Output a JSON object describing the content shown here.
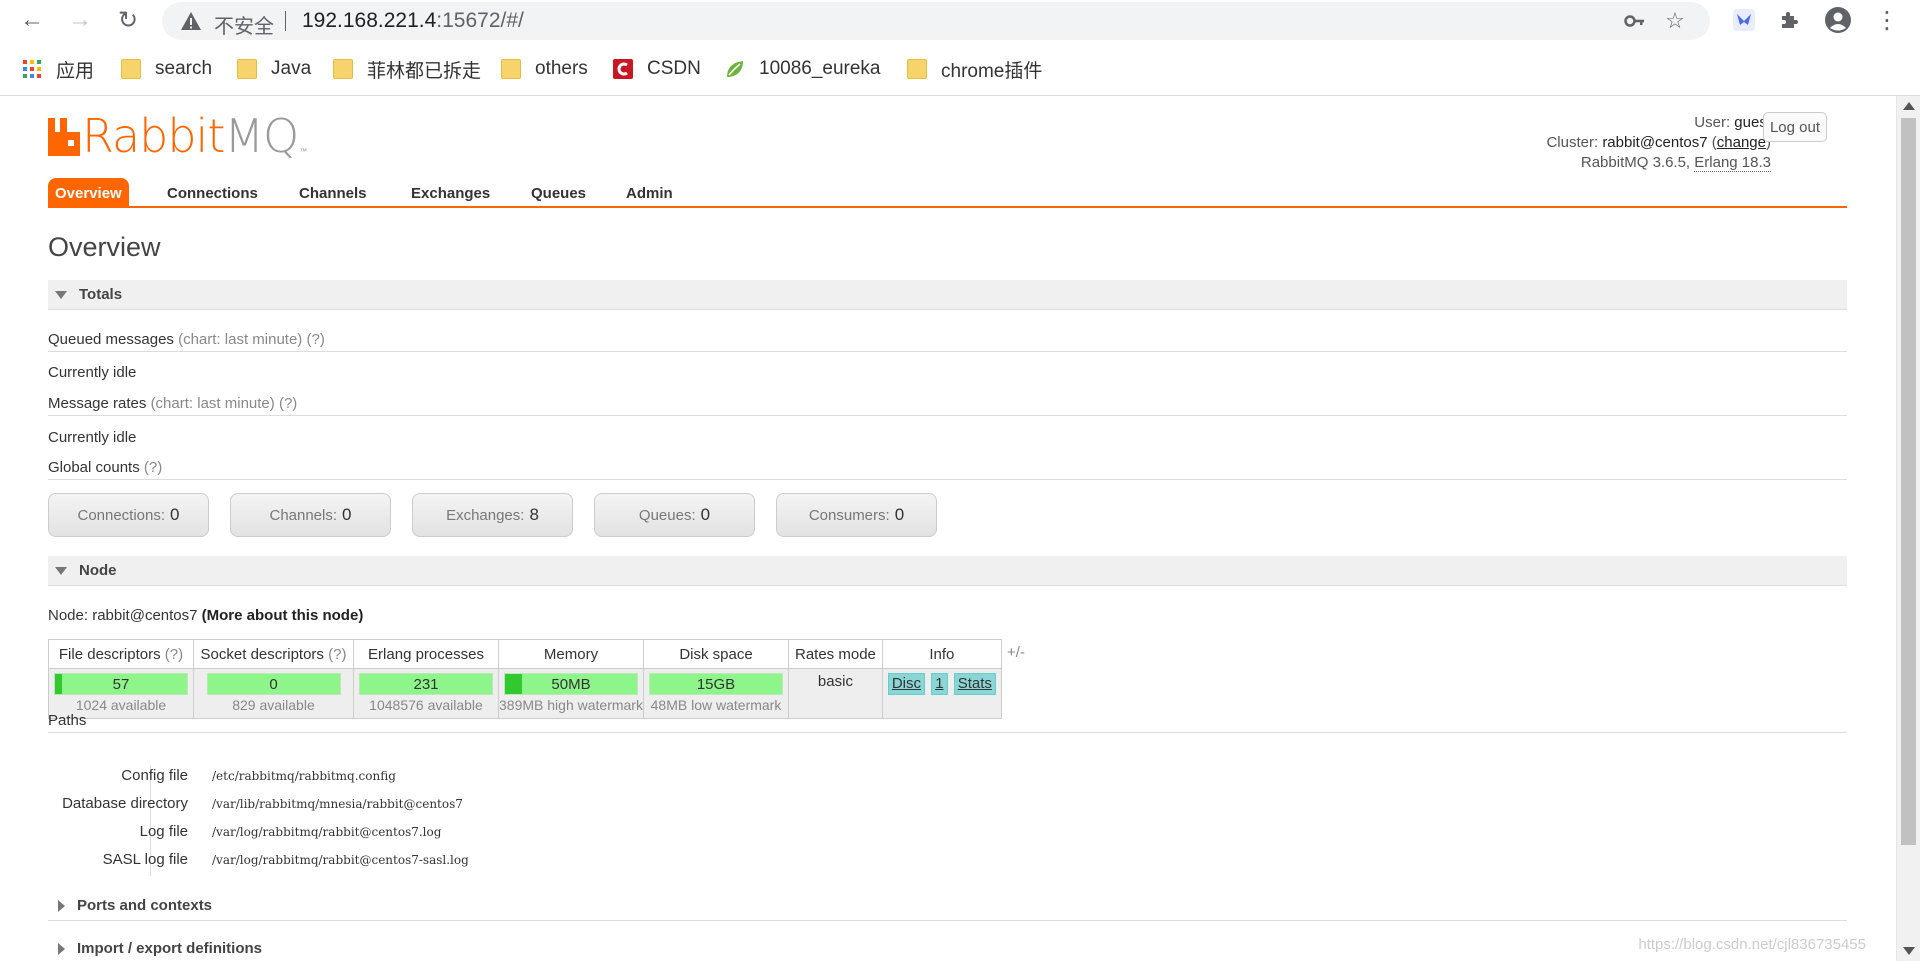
{
  "browser": {
    "insecure_label": "不安全",
    "url_host": "192.168.221.4",
    "url_rest": ":15672/#/",
    "bookmarks": [
      {
        "label": "应用"
      },
      {
        "label": "search"
      },
      {
        "label": "Java"
      },
      {
        "label": "菲林都已拆走"
      },
      {
        "label": "others"
      },
      {
        "label": "CSDN"
      },
      {
        "label": "10086_eureka"
      },
      {
        "label": "chrome插件"
      }
    ]
  },
  "header": {
    "logo_rabbit": "Rabbit",
    "logo_mq": "MQ",
    "logo_tm": "™",
    "user_label": "User:",
    "user_name": "guest",
    "cluster_label": "Cluster:",
    "cluster_name": "rabbit@centos7",
    "cluster_change": "change",
    "version": "RabbitMQ 3.6.5,",
    "erlang": "Erlang 18.3",
    "logout_label": "Log out"
  },
  "tabs": [
    {
      "label": "Overview"
    },
    {
      "label": "Connections"
    },
    {
      "label": "Channels"
    },
    {
      "label": "Exchanges"
    },
    {
      "label": "Queues"
    },
    {
      "label": "Admin"
    }
  ],
  "page_title": "Overview",
  "totals": {
    "title": "Totals",
    "queued_messages": "Queued messages",
    "queued_chart": "(chart: last minute)",
    "help": "(?)",
    "idle1": "Currently idle",
    "message_rates": "Message rates",
    "rates_chart": "(chart: last minute)",
    "idle2": "Currently idle",
    "global_counts": "Global counts",
    "counts": [
      {
        "label": "Connections:",
        "value": "0"
      },
      {
        "label": "Channels:",
        "value": "0"
      },
      {
        "label": "Exchanges:",
        "value": "8"
      },
      {
        "label": "Queues:",
        "value": "0"
      },
      {
        "label": "Consumers:",
        "value": "0"
      }
    ]
  },
  "node": {
    "title": "Node",
    "node_prefix": "Node: rabbit@centos7",
    "more": "(More about this node)",
    "headers": {
      "fd": "File descriptors",
      "sd": "Socket descriptors",
      "ep": "Erlang processes",
      "mem": "Memory",
      "disk": "Disk space",
      "rates": "Rates mode",
      "info": "Info",
      "help": "(?)"
    },
    "fd_value": "57",
    "fd_sub": "1024 available",
    "fd_fill": 0.056,
    "sd_value": "0",
    "sd_sub": "829 available",
    "sd_fill": 0.0,
    "ep_value": "231",
    "ep_sub": "1048576 available",
    "ep_fill": 0.0002,
    "mem_value": "50MB",
    "mem_sub": "389MB high watermark",
    "mem_fill": 0.13,
    "disk_value": "15GB",
    "disk_sub": "48MB low watermark",
    "disk_fill": 0.0,
    "rates_value": "basic",
    "info_disc": "Disc",
    "info_one": "1",
    "info_stats": "Stats",
    "plusminus": "+/-"
  },
  "paths": {
    "title": "Paths",
    "rows": [
      {
        "label": "Config file",
        "value": "/etc/rabbitmq/rabbitmq.config"
      },
      {
        "label": "Database directory",
        "value": "/var/lib/rabbitmq/mnesia/rabbit@centos7"
      },
      {
        "label": "Log file",
        "value": "/var/log/rabbitmq/rabbit@centos7.log"
      },
      {
        "label": "SASL log file",
        "value": "/var/log/rabbitmq/rabbit@centos7-sasl.log"
      }
    ]
  },
  "ports_title": "Ports and contexts",
  "import_title": "Import / export definitions",
  "watermark": "https://blog.csdn.net/cjl836735455"
}
